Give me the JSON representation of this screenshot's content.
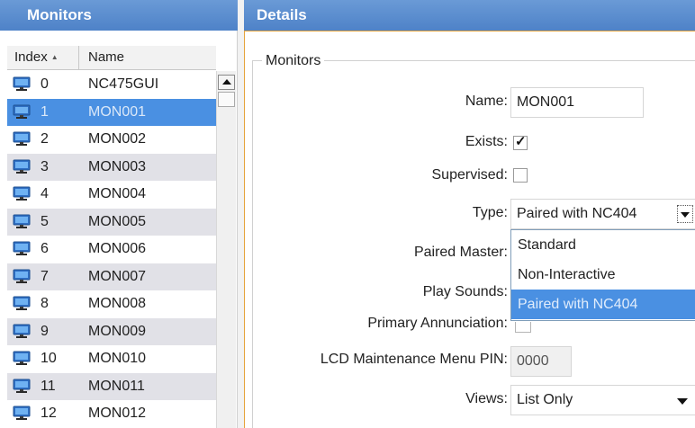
{
  "left_panel": {
    "title": "Monitors",
    "columns": {
      "index": "Index",
      "name": "Name"
    },
    "rows": [
      {
        "index": "0",
        "name": "NC475GUI"
      },
      {
        "index": "1",
        "name": "MON001"
      },
      {
        "index": "2",
        "name": "MON002"
      },
      {
        "index": "3",
        "name": "MON003"
      },
      {
        "index": "4",
        "name": "MON004"
      },
      {
        "index": "5",
        "name": "MON005"
      },
      {
        "index": "6",
        "name": "MON006"
      },
      {
        "index": "7",
        "name": "MON007"
      },
      {
        "index": "8",
        "name": "MON008"
      },
      {
        "index": "9",
        "name": "MON009"
      },
      {
        "index": "10",
        "name": "MON010"
      },
      {
        "index": "11",
        "name": "MON011"
      },
      {
        "index": "12",
        "name": "MON012"
      }
    ],
    "selected_index": 1,
    "icon": "monitor-icon"
  },
  "details": {
    "title": "Details",
    "group_title": "Monitors",
    "fields": {
      "name_label": "Name:",
      "name_value": "MON001",
      "exists_label": "Exists:",
      "exists_checked": true,
      "supervised_label": "Supervised:",
      "supervised_checked": false,
      "type_label": "Type:",
      "type_value": "Paired with NC404",
      "paired_master_label": "Paired Master:",
      "play_sounds_label": "Play Sounds:",
      "primary_annunciation_label": "Primary Annunciation:",
      "lcd_pin_label": "LCD Maintenance Menu PIN:",
      "lcd_pin_value": "0000",
      "views_label": "Views:",
      "views_value": "List Only"
    },
    "type_options": [
      "Standard",
      "Non-Interactive",
      "Paired with NC404"
    ],
    "type_highlighted": "Paired with NC404"
  },
  "colors": {
    "header_blue": "#4e82c8",
    "selection_blue": "#4a90e2",
    "alt_row": "#e1e1e7",
    "details_border": "#e5a33a"
  }
}
